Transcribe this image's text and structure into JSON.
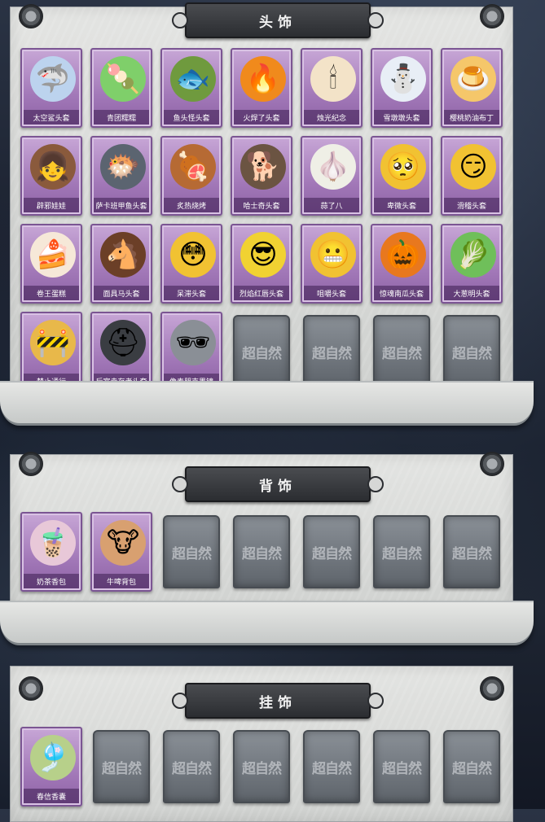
{
  "sections": [
    {
      "title": "头饰",
      "items": [
        {
          "name": "太空鲨头套",
          "emoji": "🦈",
          "bg": "#bcd3ee"
        },
        {
          "name": "青团糯糯",
          "emoji": "🍡",
          "bg": "#7fcf6a"
        },
        {
          "name": "鱼头怪头套",
          "emoji": "🐟",
          "bg": "#6f9a3e"
        },
        {
          "name": "火焊了头套",
          "emoji": "🔥",
          "bg": "#f08a1c"
        },
        {
          "name": "烛光纪念",
          "emoji": "🕯",
          "bg": "#f3e3c8"
        },
        {
          "name": "雪墩墩头套",
          "emoji": "⛄",
          "bg": "#e8eef6"
        },
        {
          "name": "樱桃奶油布丁",
          "emoji": "🍮",
          "bg": "#f5c76a"
        },
        {
          "name": "辟邪娃娃",
          "emoji": "👧",
          "bg": "#8a5a3c"
        },
        {
          "name": "萨卡班甲鱼头套",
          "emoji": "🐡",
          "bg": "#5b6470"
        },
        {
          "name": "炙热烧烤",
          "emoji": "🍖",
          "bg": "#b66a34"
        },
        {
          "name": "哈士奇头套",
          "emoji": "🐕",
          "bg": "#6b5442"
        },
        {
          "name": "蒜了八",
          "emoji": "🧄",
          "bg": "#efefe6"
        },
        {
          "name": "卑微头套",
          "emoji": "🥺",
          "bg": "#f1c232"
        },
        {
          "name": "滑稽头套",
          "emoji": "😏",
          "bg": "#f1c232"
        },
        {
          "name": "卷王蛋糕",
          "emoji": "🍰",
          "bg": "#f6e8d8"
        },
        {
          "name": "面具马头套",
          "emoji": "🐴",
          "bg": "#6b3f27"
        },
        {
          "name": "呆滞头套",
          "emoji": "😳",
          "bg": "#f1c232"
        },
        {
          "name": "烈焰红唇头套",
          "emoji": "😎",
          "bg": "#f1d232"
        },
        {
          "name": "咀嚼头套",
          "emoji": "😬",
          "bg": "#f1c232"
        },
        {
          "name": "惊魂南瓜头套",
          "emoji": "🎃",
          "bg": "#e8781e"
        },
        {
          "name": "大葱明头套",
          "emoji": "🥬",
          "bg": "#6fbf5a"
        },
        {
          "name": "禁止通行",
          "emoji": "🚧",
          "bg": "#e8b84a"
        },
        {
          "name": "后室幸存者头套",
          "emoji": "⛑",
          "bg": "#3a3d42"
        },
        {
          "name": "像素朋克墨镜",
          "emoji": "🕶",
          "bg": "#8a8f96"
        }
      ],
      "empty_count": 4,
      "watermark": "超自然"
    },
    {
      "title": "背饰",
      "items": [
        {
          "name": "奶茶香包",
          "emoji": "🧋",
          "bg": "#e8c8d8"
        },
        {
          "name": "牛啤背包",
          "emoji": "🐮",
          "bg": "#d8a070"
        }
      ],
      "empty_count": 5,
      "watermark": "超自然"
    },
    {
      "title": "挂饰",
      "items": [
        {
          "name": "春信香囊",
          "emoji": "🎐",
          "bg": "#b7d08a"
        }
      ],
      "empty_count": 6,
      "watermark": "超自然"
    }
  ]
}
